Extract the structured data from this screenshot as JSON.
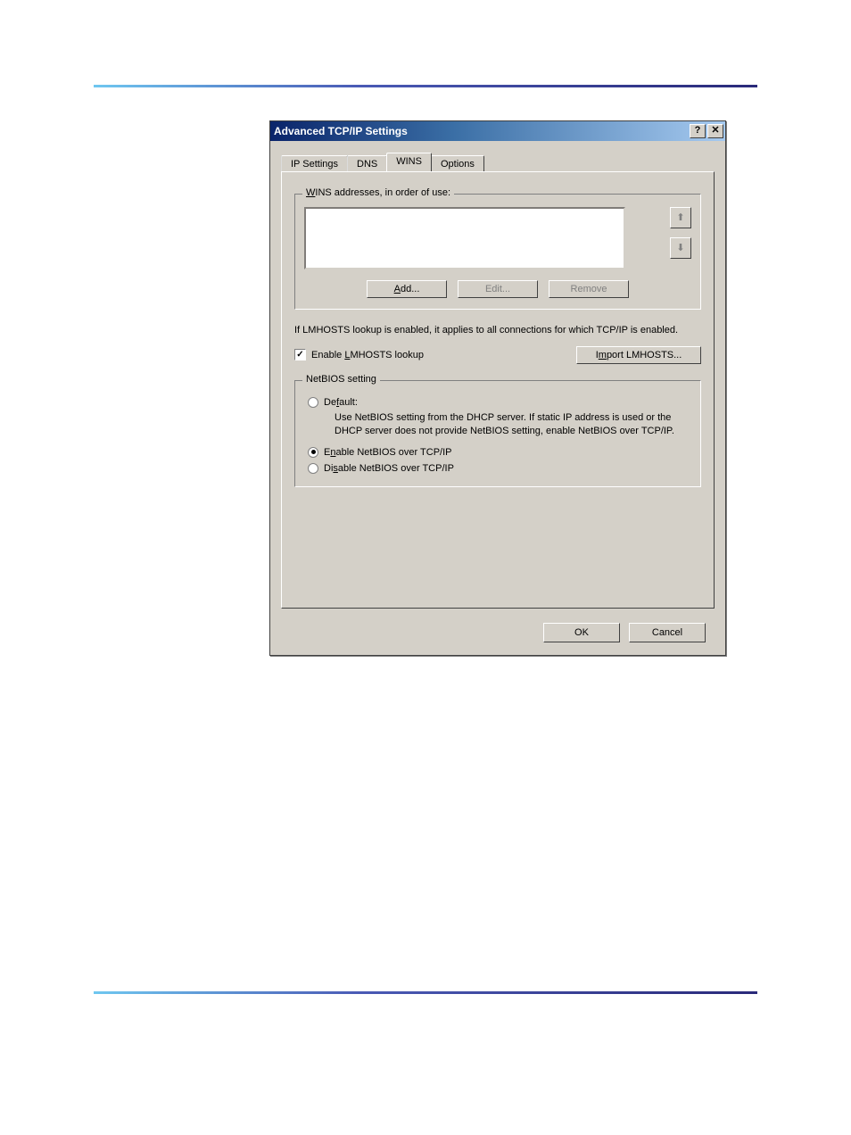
{
  "dialog": {
    "title": "Advanced TCP/IP Settings",
    "tabs": {
      "ip": "IP Settings",
      "dns": "DNS",
      "wins": "WINS",
      "options": "Options"
    },
    "wins_group_legend": "WINS addresses, in order of use:",
    "buttons": {
      "add": "Add...",
      "edit": "Edit...",
      "remove": "Remove"
    },
    "lmhosts_info": "If LMHOSTS lookup is enabled, it applies to all connections for which TCP/IP is enabled.",
    "enable_lmhosts_label": "Enable LMHOSTS lookup",
    "import_lmhosts": "Import LMHOSTS...",
    "netbios_legend": "NetBIOS setting",
    "netbios": {
      "default_label": "Default:",
      "default_desc": "Use NetBIOS setting from the DHCP server. If static IP address is used or the DHCP server does not provide NetBIOS setting, enable NetBIOS over TCP/IP.",
      "enable_label": "Enable NetBIOS over TCP/IP",
      "disable_label": "Disable NetBIOS over TCP/IP"
    },
    "footer": {
      "ok": "OK",
      "cancel": "Cancel"
    },
    "titlebar": {
      "help": "?",
      "close": "✕"
    },
    "arrows": {
      "up": "⬆",
      "down": "⬇"
    }
  }
}
